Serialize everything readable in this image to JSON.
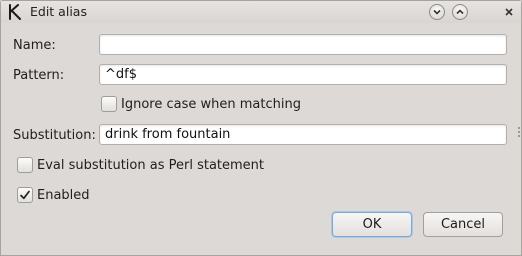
{
  "window": {
    "title": "Edit alias",
    "app_icon": "kde-app-icon",
    "controls": [
      "minimize-icon",
      "maximize-icon",
      "close-icon"
    ]
  },
  "form": {
    "name_label": "Name:",
    "name_value": "",
    "pattern_label": "Pattern:",
    "pattern_value": "^df$",
    "ignore_case_label": "Ignore case when matching",
    "ignore_case_checked": false,
    "substitution_label": "Substitution:",
    "substitution_value": "drink from fountain",
    "eval_label": "Eval substitution as Perl statement",
    "eval_checked": false,
    "enabled_label": "Enabled",
    "enabled_checked": true
  },
  "buttons": {
    "ok_label": "OK",
    "cancel_label": "Cancel"
  },
  "colors": {
    "window_bg": "#dcd9d6",
    "ok_focus": "#7fa7cf"
  }
}
